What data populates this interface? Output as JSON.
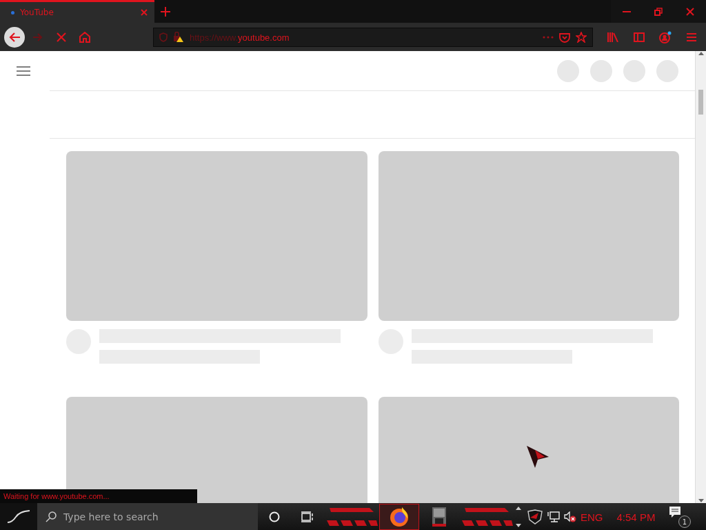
{
  "tabs": [
    {
      "title": "YouTube",
      "selected": true
    }
  ],
  "address_bar": {
    "url_scheme": "https://www.",
    "url_host": "youtube.com",
    "insecure": true
  },
  "status": "Waiting for www.youtube.com...",
  "taskbar": {
    "search_placeholder": "Type here to search",
    "apps": [
      {
        "kind": "firefox",
        "selected": true
      },
      {
        "kind": "app",
        "selected": false
      }
    ],
    "language": "ENG",
    "time": "4:54 PM",
    "notifications": "1",
    "muted": true
  }
}
